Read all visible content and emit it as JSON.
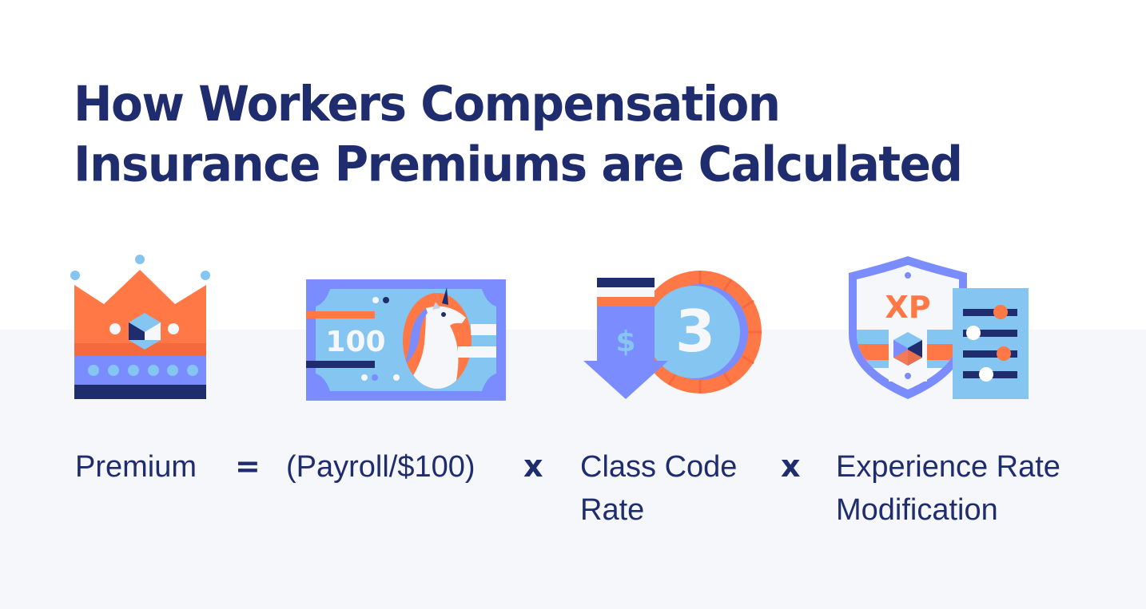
{
  "title": {
    "line1": "How Workers Compensation",
    "line2": "Insurance Premiums are Calculated"
  },
  "colors": {
    "navy": "#1f2d6e",
    "orange": "#ff7846",
    "periwinkle": "#7b8cff",
    "sky": "#84c5f2",
    "offwhite": "#f5f7fb"
  },
  "icons": {
    "premium": "crown-icon",
    "payroll": "banknote-icon",
    "class_code": "coin-price-drop-icon",
    "experience": "xp-shield-settings-icon",
    "banknote_value": "100",
    "coin_value": "3",
    "currency_symbol": "$",
    "shield_label": "XP"
  },
  "formula": {
    "premium": "Premium",
    "equals": "=",
    "payroll": "(Payroll/$100)",
    "times1": "x",
    "class_code_line1": "Class Code",
    "class_code_line2": "Rate",
    "times2": "x",
    "experience_line1": "Experience Rate",
    "experience_line2": "Modification"
  }
}
